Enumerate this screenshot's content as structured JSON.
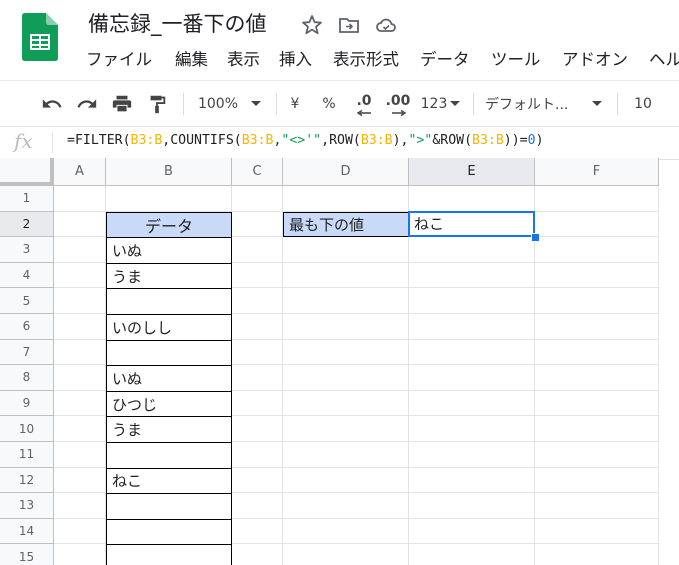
{
  "document": {
    "title": "備忘録_一番下の値"
  },
  "menu": [
    "ファイル",
    "編集",
    "表示",
    "挿入",
    "表示形式",
    "データ",
    "ツール",
    "アドオン",
    "ヘル"
  ],
  "toolbar": {
    "zoom": "100%",
    "currency": "¥",
    "percent": "%",
    "dec_decrease": ".0",
    "dec_increase": ".00",
    "more_formats": "123",
    "font": "デフォルト...",
    "font_size": "10"
  },
  "formula_bar": {
    "fx": "fx",
    "segments": [
      {
        "t": "=FILTER(",
        "k": "plain"
      },
      {
        "t": "B3:B",
        "k": "ref"
      },
      {
        "t": ",COUNTIFS(",
        "k": "plain"
      },
      {
        "t": "B3:B",
        "k": "ref"
      },
      {
        "t": ",",
        "k": "plain"
      },
      {
        "t": "\"<>'\"",
        "k": "str"
      },
      {
        "t": ",ROW(",
        "k": "plain"
      },
      {
        "t": "B3:B",
        "k": "ref"
      },
      {
        "t": "),",
        "k": "plain"
      },
      {
        "t": "\">\"",
        "k": "str"
      },
      {
        "t": "&ROW(",
        "k": "plain"
      },
      {
        "t": "B3:B",
        "k": "ref"
      },
      {
        "t": "))=",
        "k": "plain"
      },
      {
        "t": "0",
        "k": "num"
      },
      {
        "t": ")",
        "k": "plain"
      }
    ]
  },
  "columns": [
    "A",
    "B",
    "C",
    "D",
    "E",
    "F"
  ],
  "rows": [
    "1",
    "2",
    "3",
    "4",
    "5",
    "6",
    "7",
    "8",
    "9",
    "10",
    "11",
    "12",
    "13",
    "14",
    "15"
  ],
  "cells": {
    "B2": "データ",
    "B3": "いぬ",
    "B4": "うま",
    "B5": "",
    "B6": "いのしし",
    "B7": "",
    "B8": "いぬ",
    "B9": "ひつじ",
    "B10": "うま",
    "B11": "",
    "B12": "ねこ",
    "B13": "",
    "B14": "",
    "B15": "",
    "D2": "最も下の値",
    "E2": "ねこ"
  },
  "selected_cell": "E2",
  "colors": {
    "header_fill": "#c9daf8",
    "selection": "#1a73e8",
    "ref": "#f4b400",
    "string": "#0f9d58",
    "number": "#1a73e8"
  }
}
